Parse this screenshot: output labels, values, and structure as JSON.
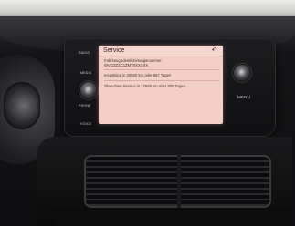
{
  "hardware_buttons": {
    "radio": "RADIO",
    "media": "MEDIA",
    "phone": "PHONE",
    "voice": "VOICE",
    "menu": "MENU"
  },
  "screen": {
    "title": "Service",
    "lines": [
      "Fahrzeug-Identifizierungsnummer:",
      "WVGZZZC1ZMY0XXXXX",
      "Inspektion in 29500 km oder 667 Tagen",
      "Ölwechsel-Service in 17600 km oder 300 Tagen"
    ]
  },
  "icons": {
    "back": "back-arrow-icon",
    "volume_knob": "volume-knob-icon",
    "tune_knob": "tune-knob-icon"
  },
  "colors": {
    "screen_bg": "#f3cfc9",
    "screen_text": "#4a2c29"
  }
}
